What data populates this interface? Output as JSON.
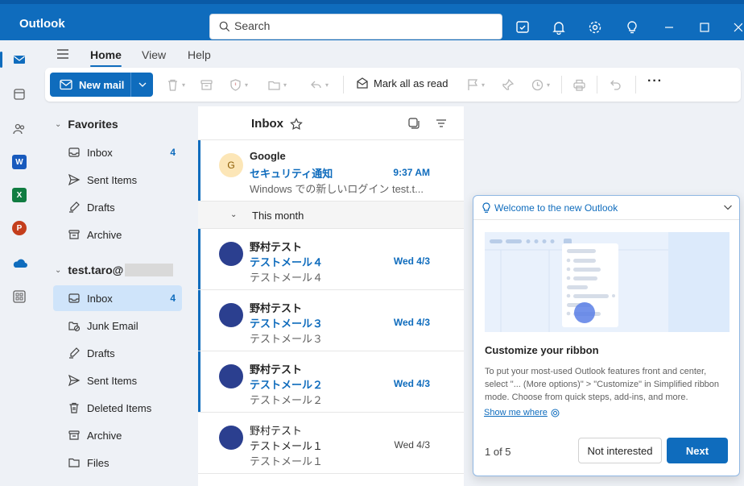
{
  "app": {
    "name": "Outlook"
  },
  "search": {
    "placeholder": "Search"
  },
  "tabs": [
    {
      "label": "Home",
      "active": true
    },
    {
      "label": "View"
    },
    {
      "label": "Help"
    }
  ],
  "ribbon": {
    "new_mail_label": "New mail",
    "mark_all_read_label": "Mark all as read",
    "more_label": "···"
  },
  "favorites": {
    "header": "Favorites",
    "items": [
      {
        "label": "Inbox",
        "icon": "inbox-icon",
        "count": "4"
      },
      {
        "label": "Sent Items",
        "icon": "send-icon"
      },
      {
        "label": "Drafts",
        "icon": "drafts-icon"
      },
      {
        "label": "Archive",
        "icon": "archive-icon"
      }
    ]
  },
  "account": {
    "header": "test.taro@",
    "items": [
      {
        "label": "Inbox",
        "icon": "inbox-icon",
        "count": "4",
        "selected": true
      },
      {
        "label": "Junk Email",
        "icon": "junk-icon"
      },
      {
        "label": "Drafts",
        "icon": "drafts-icon"
      },
      {
        "label": "Sent Items",
        "icon": "send-icon"
      },
      {
        "label": "Deleted Items",
        "icon": "trash-icon"
      },
      {
        "label": "Archive",
        "icon": "archive-icon"
      },
      {
        "label": "Files",
        "icon": "folder-icon"
      }
    ]
  },
  "message_list": {
    "title": "Inbox",
    "group_label": "This month",
    "messages": [
      {
        "avatar": "G",
        "sender": "Google",
        "subject": "セキュリティ通知",
        "preview": "Windows での新しいログイン test.t...",
        "time": "9:37 AM",
        "unread": true
      },
      {
        "avatar": "",
        "sender": "野村テスト",
        "subject": "テストメール４",
        "preview": "テストメール４",
        "time": "Wed 4/3",
        "unread": true
      },
      {
        "avatar": "",
        "sender": "野村テスト",
        "subject": "テストメール３",
        "preview": "テストメール３",
        "time": "Wed 4/3",
        "unread": true
      },
      {
        "avatar": "",
        "sender": "野村テスト",
        "subject": "テストメール２",
        "preview": "テストメール２",
        "time": "Wed 4/3",
        "unread": true
      },
      {
        "avatar": "",
        "sender": "野村テスト",
        "subject": "テストメール１",
        "preview": "テストメール１",
        "time": "Wed 4/3",
        "unread": false
      }
    ]
  },
  "callout": {
    "title": "Welcome to the new Outlook",
    "heading": "Customize your ribbon",
    "body": "To put your most-used Outlook features front and center, select \"... (More options)\" > \"Customize\" in Simplified ribbon mode. Choose from quick steps, add-ins, and more.",
    "link": "Show me where",
    "counter": "1 of 5",
    "secondary_button": "Not interested",
    "primary_button": "Next"
  },
  "colors": {
    "brand": "#0f6cbd",
    "background": "#eef1f6",
    "selected": "#cfe4fa",
    "avatar": "#2b3f8f"
  }
}
